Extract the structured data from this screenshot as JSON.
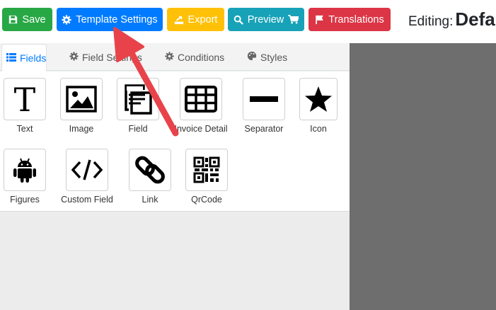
{
  "toolbar": {
    "save": "Save",
    "template_settings": "Template Settings",
    "export": "Export",
    "preview": "Preview",
    "translations": "Translations",
    "editing_label": "Editing:",
    "editing_name": "Defa"
  },
  "tabs": [
    {
      "label": "Fields",
      "icon": "list-icon",
      "active": true
    },
    {
      "label": "Field Settings",
      "icon": "gear-icon",
      "active": false
    },
    {
      "label": "Conditions",
      "icon": "gear-icon",
      "active": false
    },
    {
      "label": "Styles",
      "icon": "palette-icon",
      "active": false
    }
  ],
  "tools": [
    {
      "label": "Text",
      "icon": "text-icon"
    },
    {
      "label": "Image",
      "icon": "image-icon"
    },
    {
      "label": "Field",
      "icon": "field-icon"
    },
    {
      "label": "Invoice Detail",
      "icon": "table-icon"
    },
    {
      "label": "Separator",
      "icon": "separator-icon"
    },
    {
      "label": "Icon",
      "icon": "star-icon"
    },
    {
      "label": "Figures",
      "icon": "android-icon"
    },
    {
      "label": "Custom Field",
      "icon": "code-icon"
    },
    {
      "label": "Link",
      "icon": "link-icon"
    },
    {
      "label": "QrCode",
      "icon": "qrcode-icon"
    }
  ],
  "colors": {
    "save": "#28a745",
    "template_settings": "#007bff",
    "export": "#ffc107",
    "preview": "#17a2b8",
    "translations": "#dc3545",
    "canvas": "#6e6e6e",
    "arrow": "#e8434b"
  }
}
